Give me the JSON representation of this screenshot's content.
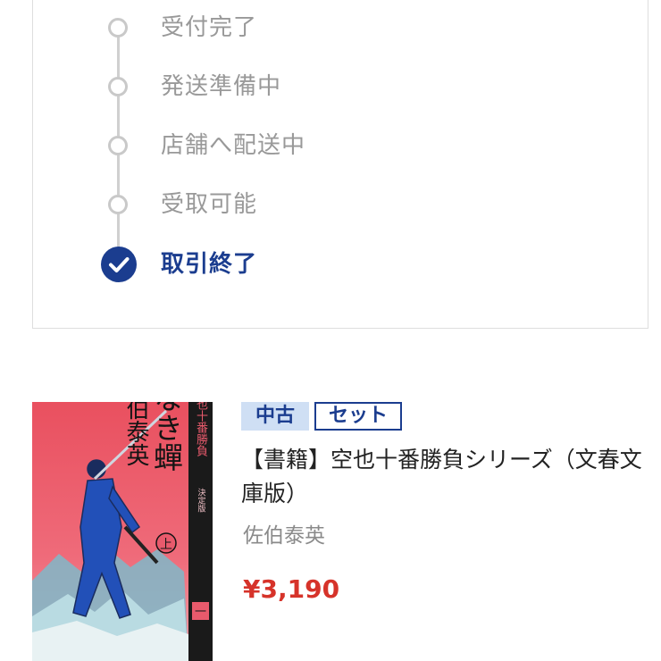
{
  "status": {
    "steps": [
      {
        "label": "受付完了",
        "state": "pending"
      },
      {
        "label": "発送準備中",
        "state": "pending"
      },
      {
        "label": "店舗へ配送中",
        "state": "pending"
      },
      {
        "label": "受取可能",
        "state": "pending"
      },
      {
        "label": "取引終了",
        "state": "done"
      }
    ],
    "active_color": "#1b3d8f",
    "inactive_color": "#c9c9c9"
  },
  "product": {
    "tags": {
      "used": "中古",
      "set": "セット"
    },
    "title": "【書籍】空也十番勝負シリーズ（文春文庫版）",
    "author": "佐伯泰英",
    "price": "¥3,190",
    "price_color": "#d6332a",
    "cover": {
      "title": "声なき蟬",
      "volume": "上",
      "author": "佐伯泰英",
      "series": "空也十番勝負",
      "edition": "決定版",
      "number": "一"
    }
  }
}
